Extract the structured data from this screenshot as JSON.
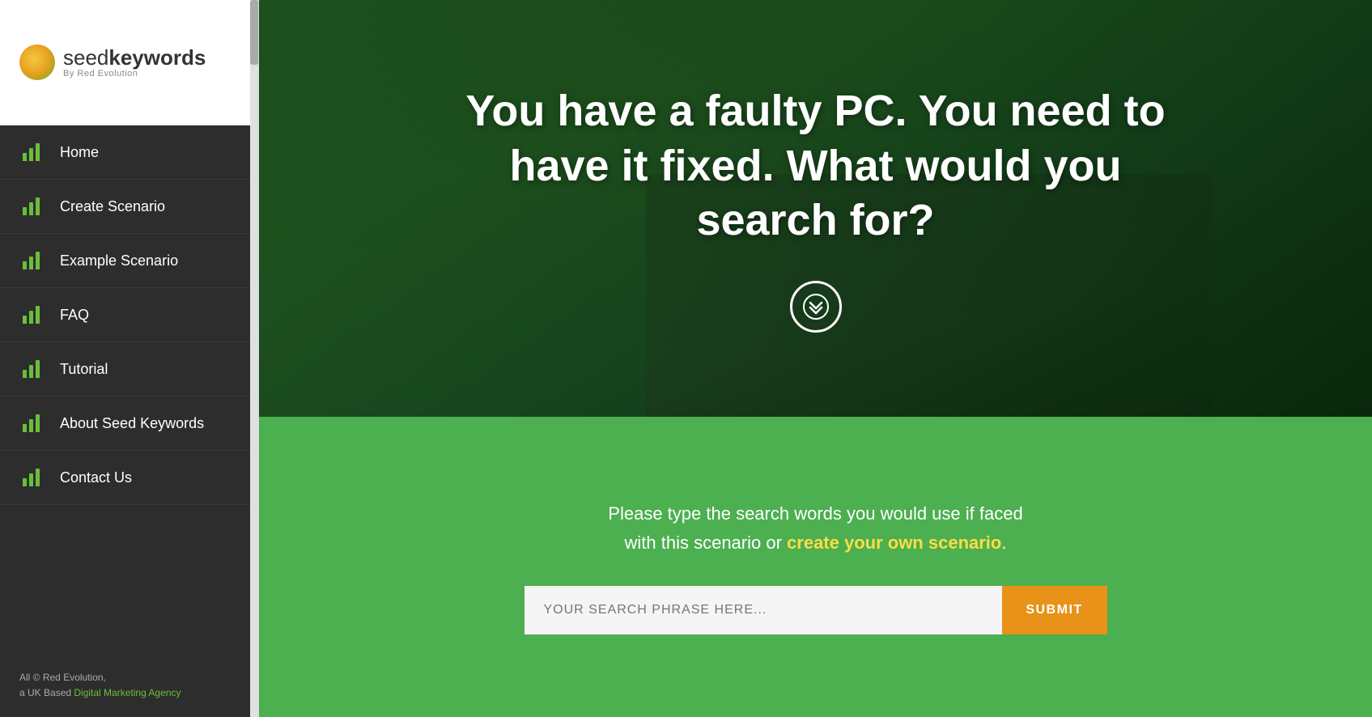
{
  "logo": {
    "brand_plain": "seed",
    "brand_bold": "keywords",
    "sub": "By Red Evolution",
    "circle_label": "logo-circle"
  },
  "nav": {
    "items": [
      {
        "id": "home",
        "label": "Home"
      },
      {
        "id": "create-scenario",
        "label": "Create Scenario"
      },
      {
        "id": "example-scenario",
        "label": "Example Scenario"
      },
      {
        "id": "faq",
        "label": "FAQ"
      },
      {
        "id": "tutorial",
        "label": "Tutorial"
      },
      {
        "id": "about",
        "label": "About Seed Keywords"
      },
      {
        "id": "contact",
        "label": "Contact Us"
      }
    ]
  },
  "footer": {
    "line1": "All © Red Evolution,",
    "line2": "a UK Based ",
    "link_text": "Digital Marketing Agency"
  },
  "hero": {
    "headline": "You have a faulty PC. You need to have it fixed. What would you search for?",
    "scroll_btn_label": "scroll down"
  },
  "green_section": {
    "description_1": "Please type the search words you would use if faced",
    "description_2": "with this scenario or ",
    "link_text": "create your own scenario",
    "link_punctuation": ".",
    "search_placeholder": "YOUR SEARCH PHRASE HERE...",
    "submit_label": "SUBMIT"
  }
}
